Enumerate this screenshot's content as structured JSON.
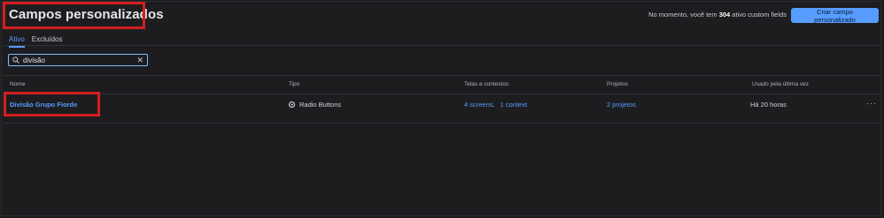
{
  "header": {
    "title": "Campos personalizados",
    "count_prefix": "No momento, você tem",
    "count_value": "304",
    "count_suffix": "ativo custom fields",
    "create_button": "Criar campo personalizado"
  },
  "tabs": [
    {
      "label": "Ativo",
      "active": true
    },
    {
      "label": "Excluídos",
      "active": false
    }
  ],
  "search": {
    "value": "divisão",
    "icon": "search-icon"
  },
  "table": {
    "columns": [
      "Nome",
      "Tipo",
      "Telas e contextos",
      "Projetos",
      "Usado pela última vez"
    ],
    "rows": [
      {
        "name": "Divisão Grupo Fiorde",
        "type": "Radio Buttons",
        "screens": "4 screens,",
        "contexts": "1 context",
        "projects": "2 projetos",
        "last_used": "Há 20 horas",
        "more": "···"
      }
    ]
  },
  "colors": {
    "accent": "#579dff",
    "highlight": "#d21f1f",
    "background": "#1d1d20"
  }
}
